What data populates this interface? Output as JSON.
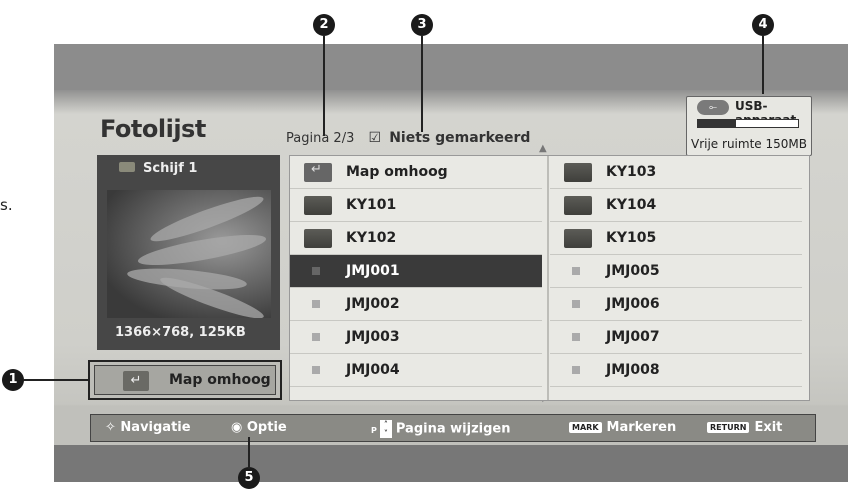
{
  "stray_text": "s.",
  "title": "Fotolijst",
  "page_info": "Pagina 2/3",
  "check_glyph": "☑",
  "mark_status": "Niets gemarkeerd",
  "usb": {
    "label": "USB-apparaat",
    "free_space": "Vrije ruimte 150MB",
    "usage_fraction": 0.38
  },
  "preview": {
    "drive": "Schijf 1",
    "dimensions": "1366×768, 125KB"
  },
  "map_button": "Map omhoog",
  "items": [
    {
      "name": "Map omhoog",
      "type": "up"
    },
    {
      "name": "KY103",
      "type": "folder"
    },
    {
      "name": "KY101",
      "type": "folder"
    },
    {
      "name": "KY104",
      "type": "folder"
    },
    {
      "name": "KY102",
      "type": "folder"
    },
    {
      "name": "KY105",
      "type": "folder"
    },
    {
      "name": "JMJ001",
      "type": "file",
      "selected": true
    },
    {
      "name": "JMJ005",
      "type": "file"
    },
    {
      "name": "JMJ002",
      "type": "file"
    },
    {
      "name": "JMJ006",
      "type": "file"
    },
    {
      "name": "JMJ003",
      "type": "file"
    },
    {
      "name": "JMJ007",
      "type": "file"
    },
    {
      "name": "JMJ004",
      "type": "file"
    },
    {
      "name": "JMJ008",
      "type": "file"
    }
  ],
  "footer": {
    "nav_label": "Navigatie",
    "option_label": "Optie",
    "page_key": "P",
    "page_label": "Pagina wijzigen",
    "mark_key": "MARK",
    "mark_label": "Markeren",
    "return_key": "RETURN",
    "exit_label": "Exit"
  },
  "callouts": [
    "1",
    "2",
    "3",
    "4",
    "5"
  ]
}
